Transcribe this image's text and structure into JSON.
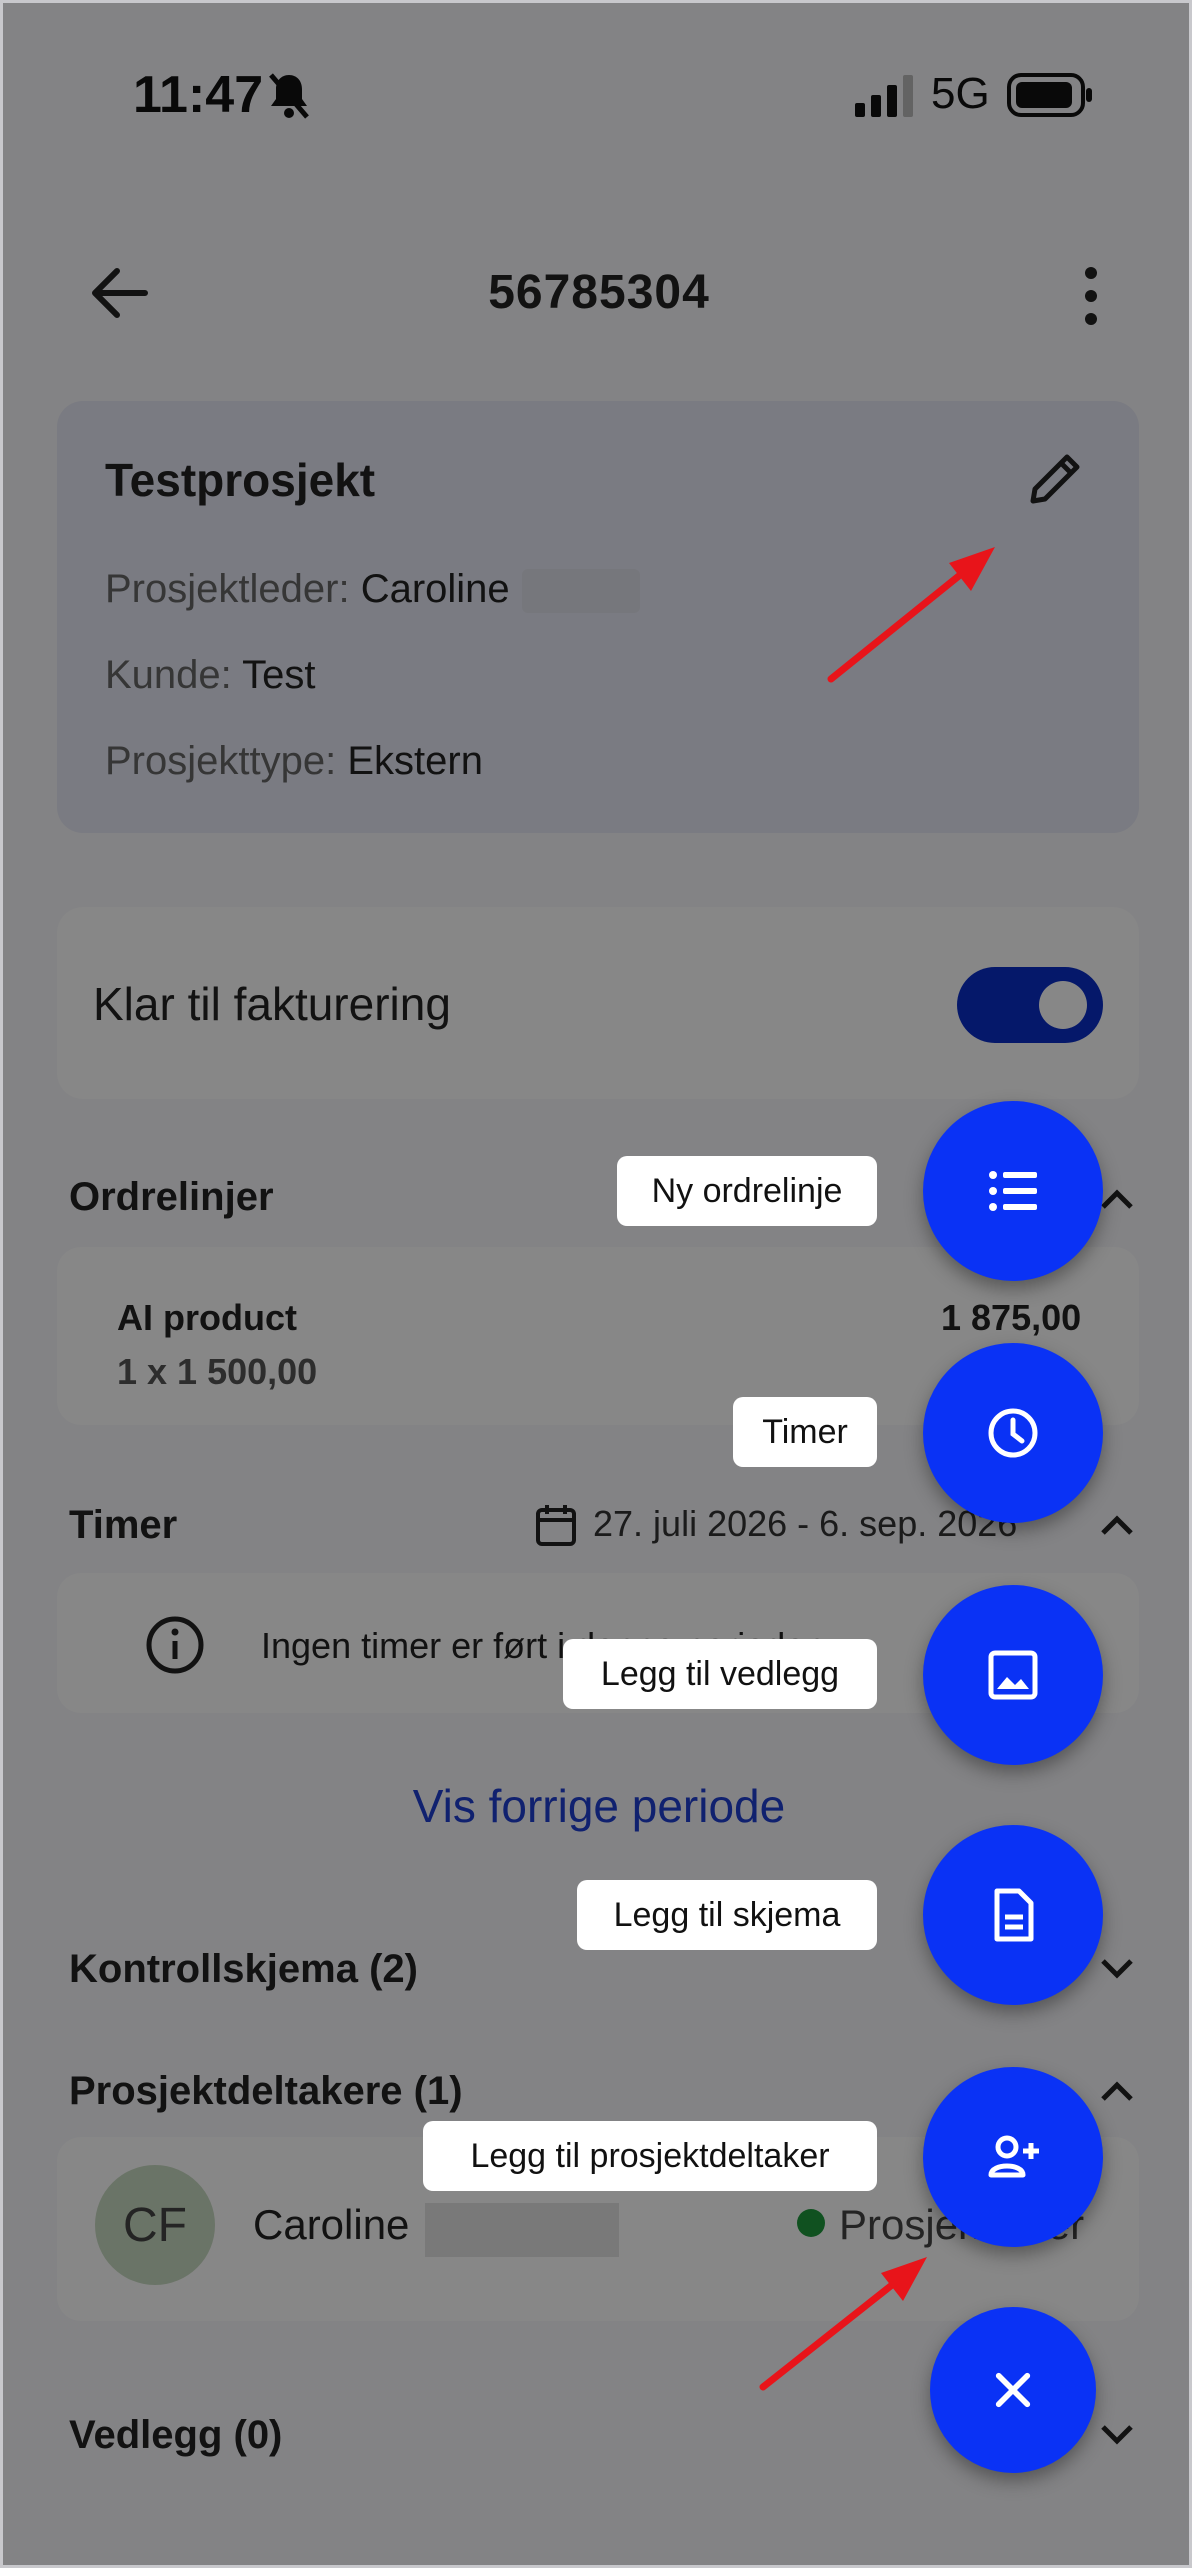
{
  "status_bar": {
    "time": "11:47",
    "network": "5G"
  },
  "header": {
    "title": "56785304"
  },
  "project_card": {
    "title": "Testprosjekt",
    "manager_label": "Prosjektleder:",
    "manager_value": "Caroline",
    "customer_label": "Kunde:",
    "customer_value": "Test",
    "type_label": "Prosjekttype:",
    "type_value": "Ekstern"
  },
  "invoice_toggle": {
    "label": "Klar til fakturering",
    "on": true
  },
  "order_lines": {
    "title": "Ordrelinjer",
    "items": [
      {
        "name": "AI product",
        "detail": "1 x 1 500,00",
        "total": "1 875,00"
      }
    ]
  },
  "hours": {
    "title": "Timer",
    "range": "27. juli 2026 - 6. sep. 2026",
    "empty_text": "Ingen timer er ført i denne perioden",
    "previous_link": "Vis forrige periode"
  },
  "forms": {
    "title": "Kontrollskjema (2)"
  },
  "participants": {
    "title": "Prosjektdeltakere (1)",
    "items": [
      {
        "initials": "CF",
        "name": "Caroline",
        "role": "Prosjektleder"
      }
    ]
  },
  "attachments": {
    "title": "Vedlegg (0)"
  },
  "fab_menu": {
    "items": [
      {
        "label": "Ny ordrelinje",
        "icon": "list-icon"
      },
      {
        "label": "Timer",
        "icon": "clock-icon"
      },
      {
        "label": "Legg til vedlegg",
        "icon": "image-icon"
      },
      {
        "label": "Legg til skjema",
        "icon": "document-icon"
      },
      {
        "label": "Legg til prosjektdeltaker",
        "icon": "add-person-icon"
      }
    ],
    "close_icon": "close-icon"
  },
  "colors": {
    "accent": "#0a32f5",
    "toggle": "#0a2ec8",
    "annotation": "#e8141a"
  }
}
